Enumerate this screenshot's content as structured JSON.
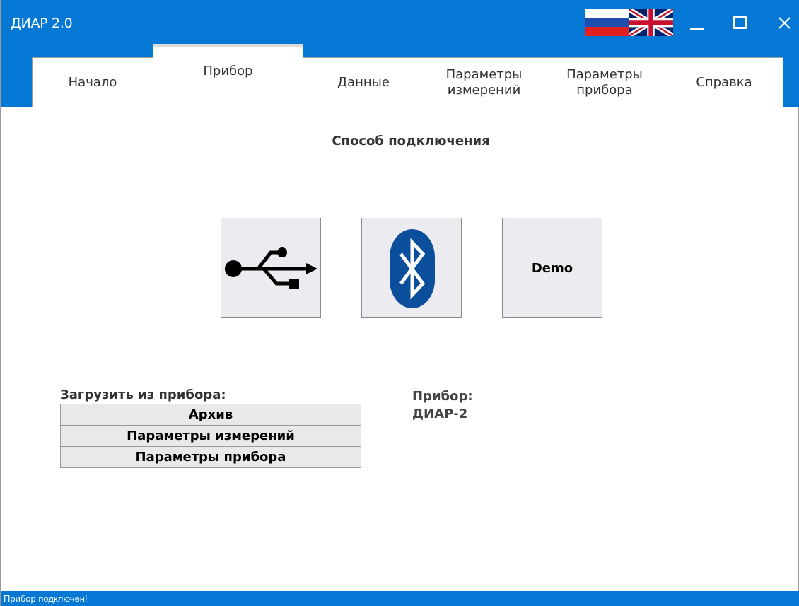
{
  "window": {
    "title": "ДИАР 2.0"
  },
  "colors": {
    "accent": "#0478d4",
    "tab_border": "#9a9a9a",
    "button_bg": "#ececf0",
    "bluetooth": "#0b4f9c"
  },
  "languages": [
    "ru-flag-icon",
    "uk-flag-icon"
  ],
  "tabs": [
    {
      "label": "Начало",
      "active": false
    },
    {
      "label": "Прибор",
      "active": true
    },
    {
      "label": "Данные",
      "active": false
    },
    {
      "label": "Параметры\nизмерений",
      "active": false
    },
    {
      "label": "Параметры\nприбора",
      "active": false
    },
    {
      "label": "Справка",
      "active": false
    }
  ],
  "connection": {
    "title": "Способ подключения",
    "usb_icon": "usb-icon",
    "bluetooth_icon": "bluetooth-icon",
    "demo_label": "Demo"
  },
  "load": {
    "label": "Загрузить из прибора:",
    "buttons": [
      "Архив",
      "Параметры измерений",
      "Параметры прибора"
    ]
  },
  "device": {
    "label": "Прибор:",
    "value": "ДИАР-2"
  },
  "status": {
    "text": "Прибор подключен!"
  }
}
